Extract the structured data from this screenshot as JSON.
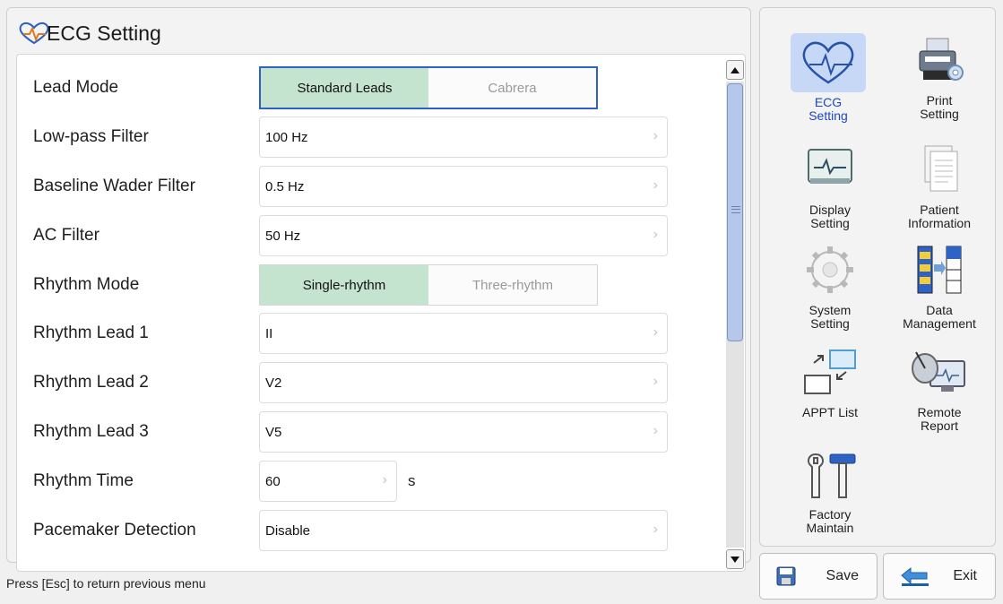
{
  "title": "ECG Setting",
  "status_text": "Press [Esc] to return previous menu",
  "rows": {
    "lead_mode": {
      "label": "Lead Mode",
      "options": [
        "Standard Leads",
        "Cabrera"
      ],
      "selected": "Standard Leads"
    },
    "low_pass": {
      "label": "Low-pass Filter",
      "value": "100 Hz"
    },
    "baseline": {
      "label": "Baseline Wader Filter",
      "value": "0.5 Hz"
    },
    "ac": {
      "label": "AC Filter",
      "value": "50 Hz"
    },
    "rhythm_mode": {
      "label": "Rhythm Mode",
      "options": [
        "Single-rhythm",
        "Three-rhythm"
      ],
      "selected": "Single-rhythm"
    },
    "rhythm_lead_1": {
      "label": "Rhythm Lead 1",
      "value": "II"
    },
    "rhythm_lead_2": {
      "label": "Rhythm Lead 2",
      "value": "V2"
    },
    "rhythm_lead_3": {
      "label": "Rhythm Lead 3",
      "value": "V5"
    },
    "rhythm_time": {
      "label": "Rhythm Time",
      "value": "60",
      "unit": "s"
    },
    "pacemaker": {
      "label": "Pacemaker Detection",
      "value": "Disable"
    }
  },
  "menu": {
    "ecg": {
      "line1": "ECG",
      "line2": "Setting"
    },
    "print": {
      "line1": "Print",
      "line2": "Setting"
    },
    "display": {
      "line1": "Display",
      "line2": "Setting"
    },
    "patient": {
      "line1": "Patient",
      "line2": "Information"
    },
    "system": {
      "line1": "System",
      "line2": "Setting"
    },
    "data": {
      "line1": "Data",
      "line2": "Management"
    },
    "appt": {
      "line1": "APPT List",
      "line2": ""
    },
    "remote": {
      "line1": "Remote",
      "line2": "Report"
    },
    "factory": {
      "line1": "Factory",
      "line2": "Maintain"
    }
  },
  "buttons": {
    "save": "Save",
    "exit": "Exit"
  },
  "chevron": "›",
  "colors": {
    "accent": "#2f62c7",
    "active_option": "#c5e4d0",
    "active_menu_bg": "#c7d7f6",
    "active_menu_text": "#1f47c0"
  }
}
